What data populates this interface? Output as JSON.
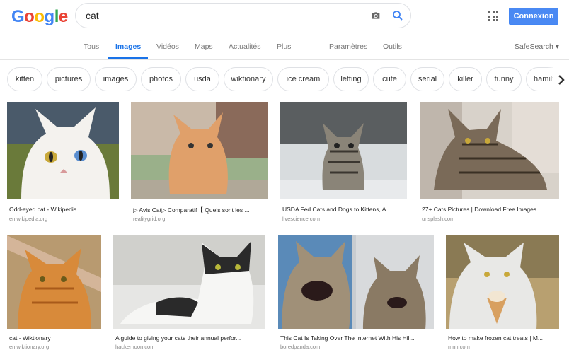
{
  "logo": "Google",
  "search": {
    "query": "cat"
  },
  "header": {
    "signin_label": "Connexion"
  },
  "tabs": [
    {
      "label": "Tous"
    },
    {
      "label": "Images"
    },
    {
      "label": "Vidéos"
    },
    {
      "label": "Maps"
    },
    {
      "label": "Actualités"
    },
    {
      "label": "Plus"
    },
    {
      "label": "Paramètres"
    },
    {
      "label": "Outils"
    }
  ],
  "safesearch_label": "SafeSearch",
  "chips": [
    "kitten",
    "pictures",
    "images",
    "photos",
    "usda",
    "wiktionary",
    "ice cream",
    "letting",
    "cute",
    "serial",
    "killer",
    "funny",
    "hamilt"
  ],
  "results": [
    {
      "caption": "Odd-eyed cat - Wikipedia",
      "source": "en.wikipedia.org"
    },
    {
      "caption": "▷ Avis Cat▷ Comparatif【 Quels sont les ...",
      "source": "realitygrid.org"
    },
    {
      "caption": "USDA Fed Cats and Dogs to Kittens, A...",
      "source": "livescience.com"
    },
    {
      "caption": "27+ Cats Pictures | Download Free Images...",
      "source": "unsplash.com"
    },
    {
      "caption": "cat - Wiktionary",
      "source": "en.wiktionary.org"
    },
    {
      "caption": "A guide to giving your cats their annual perfor...",
      "source": "hackernoon.com"
    },
    {
      "caption": "This Cat Is Taking Over The Internet With His Hil...",
      "source": "boredpanda.com"
    },
    {
      "caption": "How to make frozen cat treats | M...",
      "source": "mnn.com"
    }
  ]
}
